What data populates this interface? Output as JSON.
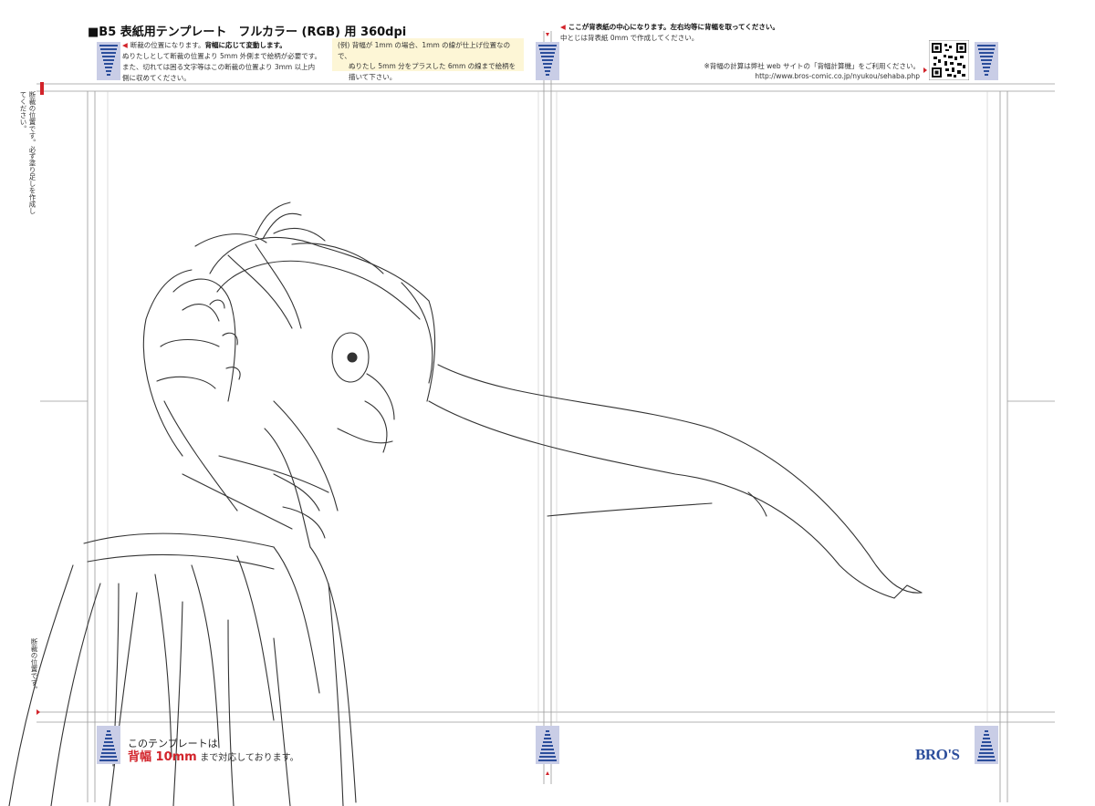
{
  "header": {
    "title": "■B5 表紙用テンプレート　フルカラー (RGB) 用 360dpi"
  },
  "notes": {
    "left_line1": "断裁の位置になります。",
    "left_line1_bold": "背幅に応じて変動します。",
    "left_line2": "ぬりたしとして断裁の位置より 5mm 外側まで絵柄が必要です。",
    "left_line3": "また、切れては困る文字等はこの断裁の位置より 3mm 以上内",
    "left_line4": "側に収めてください。",
    "example_line1": "(例) 背幅が 1mm の場合、1mm の線が仕上げ位置なので、",
    "example_line2": "ぬりたし 5mm 分をプラスした 6mm の線まで絵柄を",
    "example_line3": "描いて下さい。",
    "center_line1": "ここが背表紙の中心になります。左右均等に背幅を取ってください。",
    "center_line2": "中とじは背表紙 0mm で作成してください。",
    "right_line1": "※背幅の計算は弊社 web サイトの「背幅計算機」をご利用ください。",
    "right_line2": "http://www.bros-comic.co.jp/nyukou/sehaba.php",
    "vertical_top_1": "断裁の位置です。",
    "vertical_top_2": "必ず塗り足しを作成してください。",
    "vertical_bottom": "断裁の位置です。"
  },
  "bottom": {
    "line1": "このテンプレートは",
    "spine_label": "背幅 10mm",
    "line2_tail": "まで対応しております。"
  },
  "logo": {
    "text": "BRO'S"
  },
  "colors": {
    "accent_red": "#d2232a",
    "marker_blue": "#2b4d9b",
    "marker_bg": "#c9cde6",
    "example_bg": "#fdf6d6"
  },
  "icons": {
    "qr": "qr-code-icon",
    "registration": "registration-marker-icon"
  }
}
